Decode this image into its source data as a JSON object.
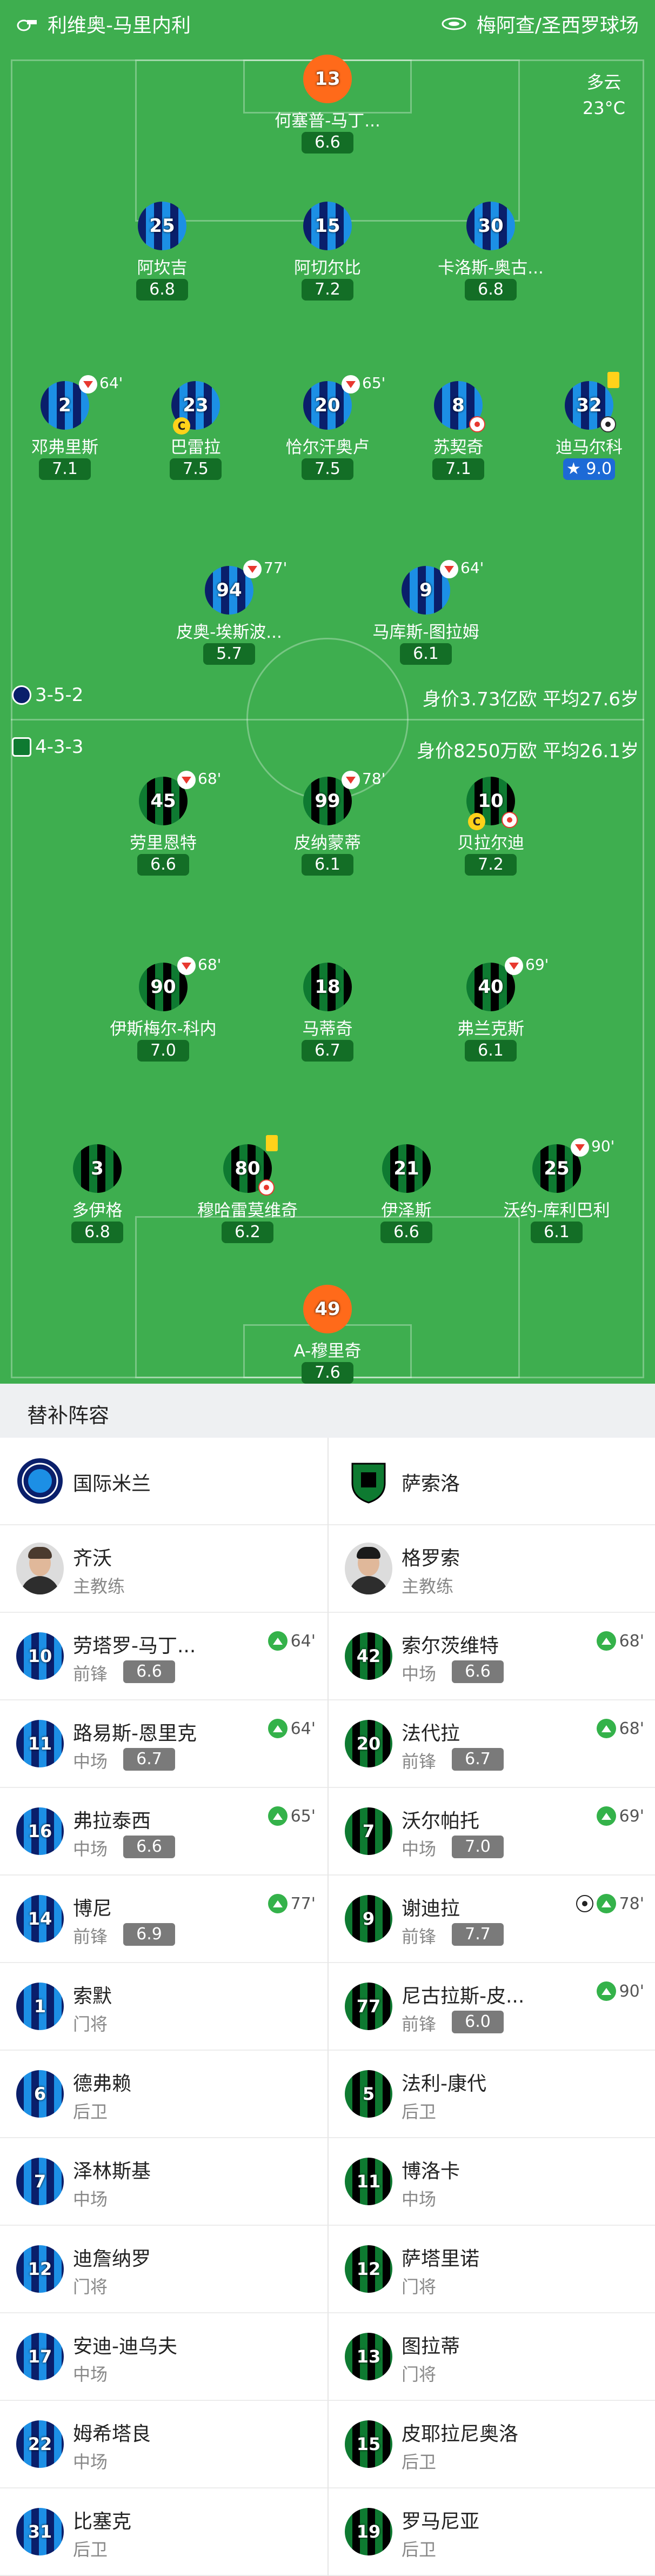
{
  "header": {
    "left_team_venue": "利维奥-马里内利",
    "right_venue": "梅阿查/圣西罗球场"
  },
  "weather": {
    "condition": "多云",
    "temperature": "23°C"
  },
  "colors": {
    "pitch": "#3eae4f",
    "inter_dark": "#0a1f6b",
    "inter_light": "#1c8fe5",
    "sass_green": "#0e7a31",
    "gk": "#ff6a1a",
    "rating_best": "#1d6ad6",
    "sub_in": "#34b24a",
    "sub_out": "#e8382f"
  },
  "inter_team": {
    "formation": "3-5-2",
    "value": "身价3.73亿欧",
    "age": "平均27.6岁"
  },
  "sass_team": {
    "formation": "4-3-3",
    "value": "身价8250万欧",
    "age": "平均26.1岁"
  },
  "inter_players": [
    {
      "num": "13",
      "name": "何塞普-马丁...",
      "rating": "6.6"
    },
    {
      "num": "25",
      "name": "阿坎吉",
      "rating": "6.8"
    },
    {
      "num": "15",
      "name": "阿切尔比",
      "rating": "7.2"
    },
    {
      "num": "30",
      "name": "卡洛斯-奥古...",
      "rating": "6.8"
    },
    {
      "num": "2",
      "name": "邓弗里斯",
      "rating": "7.1",
      "sub": "64'"
    },
    {
      "num": "23",
      "name": "巴雷拉",
      "rating": "7.5"
    },
    {
      "num": "20",
      "name": "恰尔汗奥卢",
      "rating": "7.5",
      "sub": "65'"
    },
    {
      "num": "8",
      "name": "苏契奇",
      "rating": "7.1"
    },
    {
      "num": "32",
      "name": "迪马尔科",
      "rating": "9.0"
    },
    {
      "num": "94",
      "name": "皮奥-埃斯波...",
      "rating": "5.7",
      "sub": "77'"
    },
    {
      "num": "9",
      "name": "马库斯-图拉姆",
      "rating": "6.1",
      "sub": "64'"
    }
  ],
  "sass_players": [
    {
      "num": "45",
      "name": "劳里恩特",
      "rating": "6.6",
      "sub": "68'"
    },
    {
      "num": "99",
      "name": "皮纳蒙蒂",
      "rating": "6.1",
      "sub": "78'"
    },
    {
      "num": "10",
      "name": "贝拉尔迪",
      "rating": "7.2"
    },
    {
      "num": "90",
      "name": "伊斯梅尔-科内",
      "rating": "7.0",
      "sub": "68'"
    },
    {
      "num": "18",
      "name": "马蒂奇",
      "rating": "6.7"
    },
    {
      "num": "40",
      "name": "弗兰克斯",
      "rating": "6.1",
      "sub": "69'"
    },
    {
      "num": "3",
      "name": "多伊格",
      "rating": "6.8"
    },
    {
      "num": "80",
      "name": "穆哈雷莫维奇",
      "rating": "6.2"
    },
    {
      "num": "21",
      "name": "伊泽斯",
      "rating": "6.6"
    },
    {
      "num": "25",
      "name": "沃约-库利巴利",
      "rating": "6.1",
      "sub": "90'"
    },
    {
      "num": "49",
      "name": "A-穆里奇",
      "rating": "7.6"
    }
  ],
  "subs": {
    "title": "替补阵容",
    "left_team": "国际米兰",
    "right_team": "萨索洛",
    "left_coach": {
      "name": "齐沃",
      "role": "主教练"
    },
    "right_coach": {
      "name": "格罗索",
      "role": "主教练"
    },
    "left": [
      {
        "num": "10",
        "name": "劳塔罗-马丁...",
        "pos": "前锋",
        "rating": "6.6",
        "min": "64'"
      },
      {
        "num": "11",
        "name": "路易斯-恩里克",
        "pos": "中场",
        "rating": "6.7",
        "min": "64'"
      },
      {
        "num": "16",
        "name": "弗拉泰西",
        "pos": "中场",
        "rating": "6.6",
        "min": "65'"
      },
      {
        "num": "14",
        "name": "博尼",
        "pos": "前锋",
        "rating": "6.9",
        "min": "77'"
      },
      {
        "num": "1",
        "name": "索默",
        "pos": "门将"
      },
      {
        "num": "6",
        "name": "德弗赖",
        "pos": "后卫"
      },
      {
        "num": "7",
        "name": "泽林斯基",
        "pos": "中场"
      },
      {
        "num": "12",
        "name": "迪詹纳罗",
        "pos": "门将"
      },
      {
        "num": "17",
        "name": "安迪-迪乌夫",
        "pos": "中场"
      },
      {
        "num": "22",
        "name": "姆希塔良",
        "pos": "中场"
      },
      {
        "num": "31",
        "name": "比塞克",
        "pos": "后卫"
      }
    ],
    "right": [
      {
        "num": "42",
        "name": "索尔茨维特",
        "pos": "中场",
        "rating": "6.6",
        "min": "68'"
      },
      {
        "num": "20",
        "name": "法代拉",
        "pos": "前锋",
        "rating": "6.7",
        "min": "68'"
      },
      {
        "num": "7",
        "name": "沃尔帕托",
        "pos": "中场",
        "rating": "7.0",
        "min": "69'"
      },
      {
        "num": "9",
        "name": "谢迪拉",
        "pos": "前锋",
        "rating": "7.7",
        "min": "78'"
      },
      {
        "num": "77",
        "name": "尼古拉斯-皮...",
        "pos": "前锋",
        "rating": "6.0",
        "min": "90'"
      },
      {
        "num": "5",
        "name": "法利-康代",
        "pos": "后卫"
      },
      {
        "num": "11",
        "name": "博洛卡",
        "pos": "中场"
      },
      {
        "num": "12",
        "name": "萨塔里诺",
        "pos": "门将"
      },
      {
        "num": "13",
        "name": "图拉蒂",
        "pos": "门将"
      },
      {
        "num": "15",
        "name": "皮耶拉尼奥洛",
        "pos": "后卫"
      },
      {
        "num": "19",
        "name": "罗马尼亚",
        "pos": "后卫"
      }
    ]
  }
}
